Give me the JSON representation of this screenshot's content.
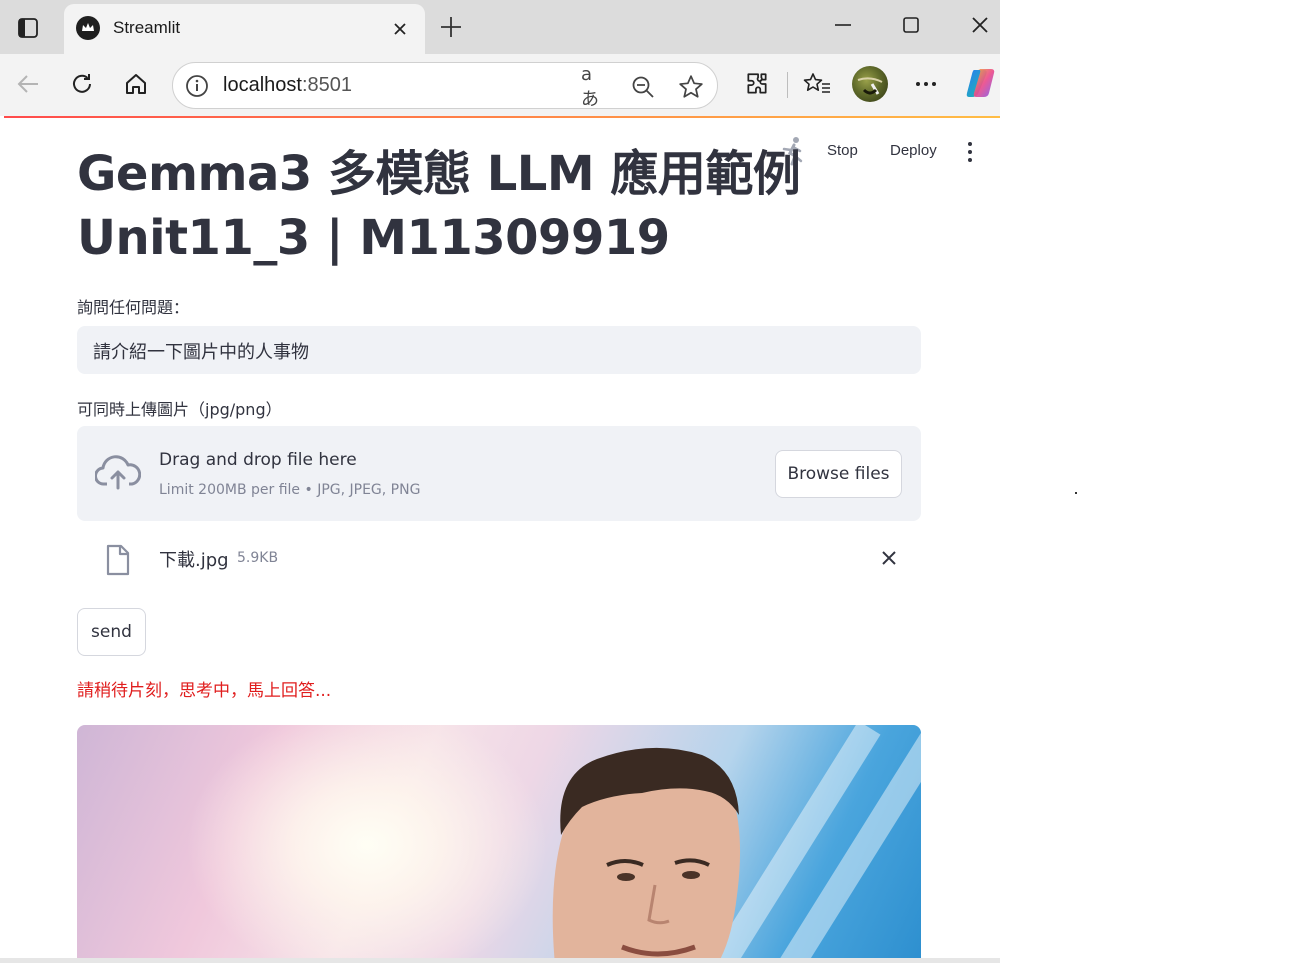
{
  "browser": {
    "tab_title": "Streamlit",
    "url_host": "localhost",
    "url_port": ":8501",
    "read_aloud_label": "aあ"
  },
  "streamlit_header": {
    "stop_label": "Stop",
    "deploy_label": "Deploy"
  },
  "app": {
    "title_line1": "Gemma3 多模態 LLM 應用範例",
    "title_line2": "Unit11_3 | M11309919",
    "question_label": "詢問任何問題：",
    "question_value": "請介紹一下圖片中的人事物",
    "upload_label": "可同時上傳圖片（jpg/png）",
    "dropzone_title": "Drag and drop file here",
    "dropzone_limit": "Limit 200MB per file • JPG, JPEG, PNG",
    "browse_label": "Browse files",
    "file_name": "下載.jpg",
    "file_size": "5.9KB",
    "send_label": "send",
    "waiting_message": "請稍待片刻，思考中，馬上回答..."
  },
  "colors": {
    "text": "#31333f",
    "input_bg": "#f0f2f6",
    "waiting": "#e01d1d",
    "accent_start": "#ff4b4b",
    "accent_end": "#ffbd45"
  },
  "icons": [
    "tab-actions-icon",
    "streamlit-crown-icon",
    "close-icon",
    "plus-icon",
    "minimize-icon",
    "maximize-icon",
    "back-icon",
    "refresh-icon",
    "home-icon",
    "info-icon",
    "zoom-out-icon",
    "star-icon",
    "extensions-icon",
    "favorites-icon",
    "more-icon",
    "copilot-icon",
    "running-icon",
    "kebab-menu-icon",
    "cloud-upload-icon",
    "file-icon"
  ]
}
